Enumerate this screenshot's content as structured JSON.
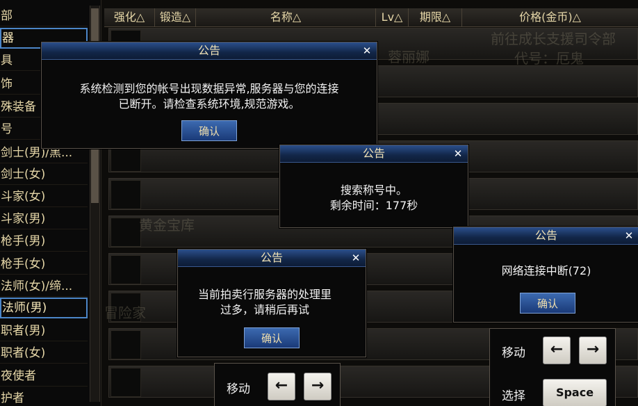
{
  "sidebar": {
    "items": [
      "部",
      "器",
      "具",
      "饰",
      "殊装备",
      "号",
      "剑士(男)/黑...",
      "剑士(女)",
      "斗家(女)",
      "斗家(男)",
      "枪手(男)",
      "枪手(女)",
      "法师(女)/缔...",
      "法师(男)",
      "职者(男)",
      "职者(女)",
      "夜使者",
      "护者"
    ],
    "selected": [
      "器",
      "法师(男)"
    ]
  },
  "table": {
    "headers": [
      "强化△",
      "锻造△",
      "名称△",
      "Lv△",
      "期限△",
      "价格(金币)△"
    ]
  },
  "background_text": [
    "前往成长支援司令部",
    "代号：厄鬼",
    "蓉丽娜",
    "黄金宝库",
    "冒险家"
  ],
  "dialogs": {
    "d1": {
      "title": "公告",
      "message": "系统检测到您的帐号出现数据异常,服务器与您的连接\n已断开。请检查系统环境,规范游戏。",
      "ok": "确认",
      "close": "✕"
    },
    "d2": {
      "title": "公告",
      "message": "搜索称号中。\n剩余时间：177秒",
      "close": "✕"
    },
    "d3": {
      "title": "公告",
      "message": "当前拍卖行服务器的处理里\n过多，请稍后再试",
      "ok": "确认",
      "close": "✕"
    },
    "d4": {
      "title": "公告",
      "message": "网络连接中断(72)",
      "ok": "确认",
      "close": "✕"
    }
  },
  "keys": {
    "move_label": "移动",
    "select_label": "选择",
    "left": "←",
    "right": "→",
    "space": "Space"
  },
  "colors": {
    "title_bar": "#1a3a78",
    "text_gold": "#e6d7a8",
    "selection": "#4c86c8"
  }
}
